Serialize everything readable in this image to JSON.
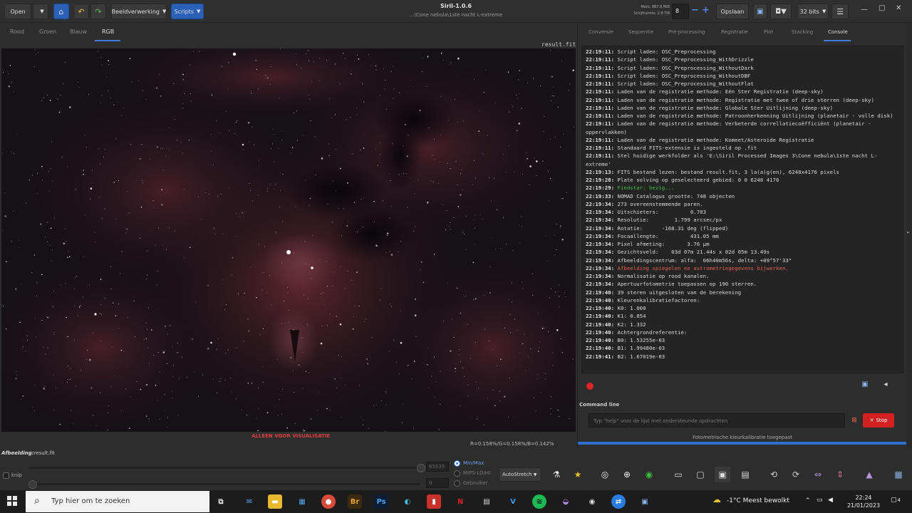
{
  "header": {
    "open": "Open",
    "image_processing": "Beeldverwerking",
    "scripts": "Scripts",
    "title": "Siril-1.0.6",
    "subtitle": "...\\Cone nebula\\1ste nacht L-extreme",
    "mem": "Mem: 887.8 MiB",
    "disk": "Schijfruimte: 2.8 TiB",
    "threads": "8",
    "save": "Opslaan",
    "bits": "32 bits"
  },
  "image_tabs": [
    "Rood",
    "Groen",
    "Blauw",
    "RGB"
  ],
  "image": {
    "filename": "result.fit",
    "viz_warning": "ALLEEN VOOR VISUALISATIE",
    "pixel_info": "R=0.158%/G=0.158%/B=0.142%"
  },
  "bottom": {
    "afbeelding_label": "Afbeelding:",
    "afbeelding_value": "result.fit",
    "knip": "knip",
    "hi_value": "65535",
    "lo_value": "0",
    "minmax": "Min/Max",
    "mips": "MIPS-LO/HI",
    "gebruiker": "Gebruiker",
    "autostretch": "AutoStretch"
  },
  "right_tabs": [
    "Conversie",
    "Sequentie",
    "Pré-processing",
    "Registratie",
    "Plot",
    "Stacking",
    "Console"
  ],
  "console": [
    {
      "t": "22:19:11:",
      "m": "Script laden: OSC_Preprocessing",
      "c": ""
    },
    {
      "t": "22:19:11:",
      "m": "Script laden: OSC_Preprocessing_WithDrizzle",
      "c": ""
    },
    {
      "t": "22:19:11:",
      "m": "Script laden: OSC_Preprocessing_WithoutDark",
      "c": ""
    },
    {
      "t": "22:19:11:",
      "m": "Script laden: OSC_Preprocessing_WithoutDBF",
      "c": ""
    },
    {
      "t": "22:19:11:",
      "m": "Script laden: OSC_Preprocessing_WithoutFlat",
      "c": ""
    },
    {
      "t": "22:19:11:",
      "m": "Laden van de registratie methode: Eén Ster Registratie (deep-sky)",
      "c": ""
    },
    {
      "t": "22:19:11:",
      "m": "Laden van de registratie methode: Registratie met twee of drie sterren (deep-sky)",
      "c": ""
    },
    {
      "t": "22:19:11:",
      "m": "Laden van de registratie methode: Globale Ster Uitlijning (deep-sky)",
      "c": ""
    },
    {
      "t": "22:19:11:",
      "m": "Laden van de registratie methode: Patroonherkenning Uitlijning (planetair - volle disk)",
      "c": ""
    },
    {
      "t": "22:19:11:",
      "m": "Laden van de registratie methode: Verbeterde correllatiecoëfficiënt (planetair - oppervlakken)",
      "c": ""
    },
    {
      "t": "22:19:11:",
      "m": "Laden van de registratie methode: Komeet/Asteroide Registratie",
      "c": ""
    },
    {
      "t": "22:19:11:",
      "m": "Standaard FITS-extensie is ingesteld op .fit",
      "c": ""
    },
    {
      "t": "22:19:11:",
      "m": "Stel huidige werkfolder als 'E:\\Siril Processed Images 3\\Cone nebula\\1ste nacht L-extreme'",
      "c": ""
    },
    {
      "t": "22:19:13:",
      "m": "FITS bestand lezen: bestand result.fit, 3 la(a)g(en), 6248x4176 pixels",
      "c": ""
    },
    {
      "t": "22:19:28:",
      "m": "Plate solving op geselecteerd gebied: 0 0 6248 4176",
      "c": ""
    },
    {
      "t": "22:19:29:",
      "m": "Findstar: bezig...",
      "c": "green"
    },
    {
      "t": "22:19:33:",
      "m": "NOMAD Catalogus grootte: 748 objecten",
      "c": ""
    },
    {
      "t": "22:19:34:",
      "m": "273 overeenstemmende paren.",
      "c": ""
    },
    {
      "t": "22:19:34:",
      "m": "Uitschieters:          0.703",
      "c": ""
    },
    {
      "t": "22:19:34:",
      "m": "Resolutie:        1.799 arcsec/px",
      "c": ""
    },
    {
      "t": "22:19:34:",
      "m": "Rotatie:      -168.31 deg (flipped)",
      "c": ""
    },
    {
      "t": "22:19:34:",
      "m": "Focaallengte:          431.05 mm",
      "c": ""
    },
    {
      "t": "22:19:34:",
      "m": "Pixel afmeting:       3.76 µm",
      "c": ""
    },
    {
      "t": "22:19:34:",
      "m": "Gezichtsveld:    03d 07m 21.44s x 02d 05m 13.49s",
      "c": ""
    },
    {
      "t": "22:19:34:",
      "m": "Afbeeldingscentrum: alfa:  06h40m56s, delta: +09°57'33\"",
      "c": ""
    },
    {
      "t": "22:19:34:",
      "m": "Afbeelding spiegelen en astrometriegegevens bijwerken.",
      "c": "red"
    },
    {
      "t": "22:19:34:",
      "m": "Normalisatie op rood kanalen.",
      "c": ""
    },
    {
      "t": "22:19:34:",
      "m": "Apertuurfotometrie toepassen op 190 sterren.",
      "c": ""
    },
    {
      "t": "22:19:40:",
      "m": "39 steren uitgesloten van de berekening",
      "c": ""
    },
    {
      "t": "22:19:40:",
      "m": "Kleurenkalibratiefactoren:",
      "c": ""
    },
    {
      "t": "22:19:40:",
      "m": "K0: 1.000",
      "c": ""
    },
    {
      "t": "22:19:40:",
      "m": "K1: 0.854",
      "c": ""
    },
    {
      "t": "22:19:40:",
      "m": "K2: 1.332",
      "c": ""
    },
    {
      "t": "22:19:40:",
      "m": "Achtergrondreferentie:",
      "c": ""
    },
    {
      "t": "22:19:40:",
      "m": "B0: 1.53255e-03",
      "c": ""
    },
    {
      "t": "22:19:40:",
      "m": "B1: 1.99480e-03",
      "c": ""
    },
    {
      "t": "22:19:41:",
      "m": "B2: 1.67019e-03",
      "c": ""
    }
  ],
  "command": {
    "label": "Command line",
    "placeholder": "Typ \"help\" voor de lijst met ondersteunde opdrachten",
    "stop": "Stop"
  },
  "status": "Fotometrische kleurkalibratie toegepast",
  "progress_fraction": 1.0,
  "taskbar": {
    "search": "Typ hier om te zoeken",
    "weather": "-1°C  Meest bewolkt",
    "time": "22:24",
    "date": "21/01/2023",
    "notif_count": "4"
  },
  "icons": [
    "home-icon",
    "undo-icon",
    "redo-icon",
    "hamburger-menu-icon",
    "record-icon",
    "broom-icon",
    "stop-icon"
  ],
  "colors": {
    "accent": "#2a60b8",
    "stop": "#d32020",
    "log_green": "#3dbd3d",
    "log_red": "#e06050"
  }
}
